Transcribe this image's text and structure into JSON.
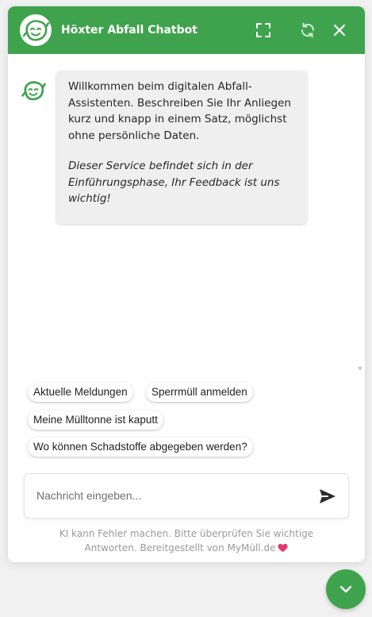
{
  "header": {
    "title": "Höxter Abfall Chatbot",
    "logo_icon": "smiling-leaf-logo-icon",
    "buttons": {
      "fullscreen_icon": "fullscreen-icon",
      "refresh_icon": "refresh-icon",
      "close_icon": "close-icon"
    }
  },
  "conversation": {
    "bot_avatar_icon": "smiling-leaf-avatar-icon",
    "welcome_lines": [
      "Willkommen beim digitalen Abfall-",
      "Assistenten. Beschreiben Sie Ihr Anliegen",
      "kurz und knapp in einem Satz, möglichst",
      "ohne persönliche Daten."
    ],
    "note_lines": [
      "Dieser Service befindet sich in der",
      "Einführungsphase, Ihr Feedback ist uns",
      "wichtig!"
    ]
  },
  "suggestions": [
    "Aktuelle Meldungen",
    "Sperrmüll anmelden",
    "Meine Mülltonne ist kaputt",
    "Wo können Schadstoffe abgegeben werden?"
  ],
  "composer": {
    "placeholder": "Nachricht eingeben...",
    "value": "",
    "send_icon": "send-icon"
  },
  "footer": {
    "disclaimer_line1": "KI kann Fehler machen. Bitte überprüfen Sie wichtige",
    "disclaimer_line2": "Antworten. Bereitgestellt von MyMüll.de",
    "heart_icon": "heart-icon"
  },
  "launcher": {
    "icon": "chevron-down-icon"
  },
  "colors": {
    "brand_green": "#3fa34d",
    "bubble_bg": "#efefef",
    "heart_pink": "#e8386f"
  }
}
